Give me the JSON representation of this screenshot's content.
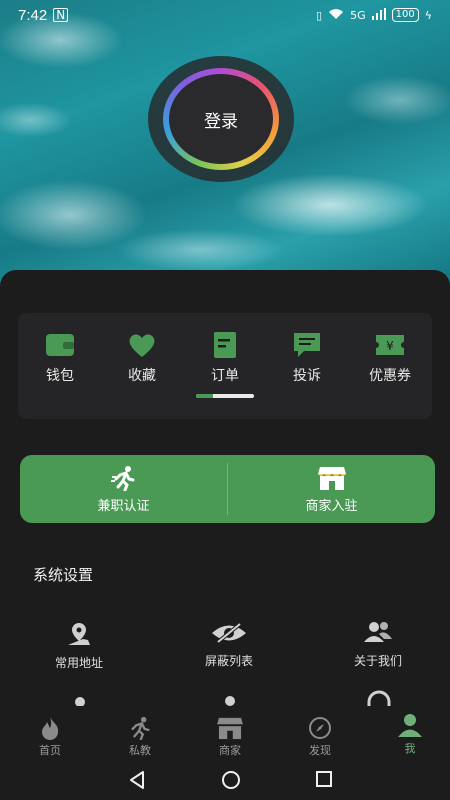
{
  "status_bar": {
    "time": "7:42",
    "network": "5G",
    "battery": "100"
  },
  "login": {
    "label": "登录"
  },
  "quick_actions": [
    {
      "label": "钱包",
      "icon": "wallet-icon"
    },
    {
      "label": "收藏",
      "icon": "heart-icon"
    },
    {
      "label": "订单",
      "icon": "order-icon"
    },
    {
      "label": "投诉",
      "icon": "complaint-icon"
    },
    {
      "label": "优惠券",
      "icon": "coupon-icon"
    }
  ],
  "quick_actions_scroll": {
    "position": 0.3
  },
  "banners": [
    {
      "label": "兼职认证",
      "icon": "running-person-icon"
    },
    {
      "label": "商家入驻",
      "icon": "storefront-icon"
    }
  ],
  "system_settings": {
    "title": "系统设置",
    "items": [
      {
        "label": "常用地址",
        "icon": "location-icon"
      },
      {
        "label": "屏蔽列表",
        "icon": "eye-off-icon"
      },
      {
        "label": "关于我们",
        "icon": "people-icon"
      }
    ]
  },
  "bottom_nav": [
    {
      "label": "首页",
      "icon": "flame-icon",
      "active": false
    },
    {
      "label": "私教",
      "icon": "runner-icon",
      "active": false
    },
    {
      "label": "商家",
      "icon": "shop-icon",
      "active": false
    },
    {
      "label": "发现",
      "icon": "compass-icon",
      "active": false
    },
    {
      "label": "我",
      "icon": "profile-icon",
      "active": true
    }
  ],
  "colors": {
    "accent": "#4a9a55",
    "background": "#1c1c1d",
    "card": "#252527"
  }
}
